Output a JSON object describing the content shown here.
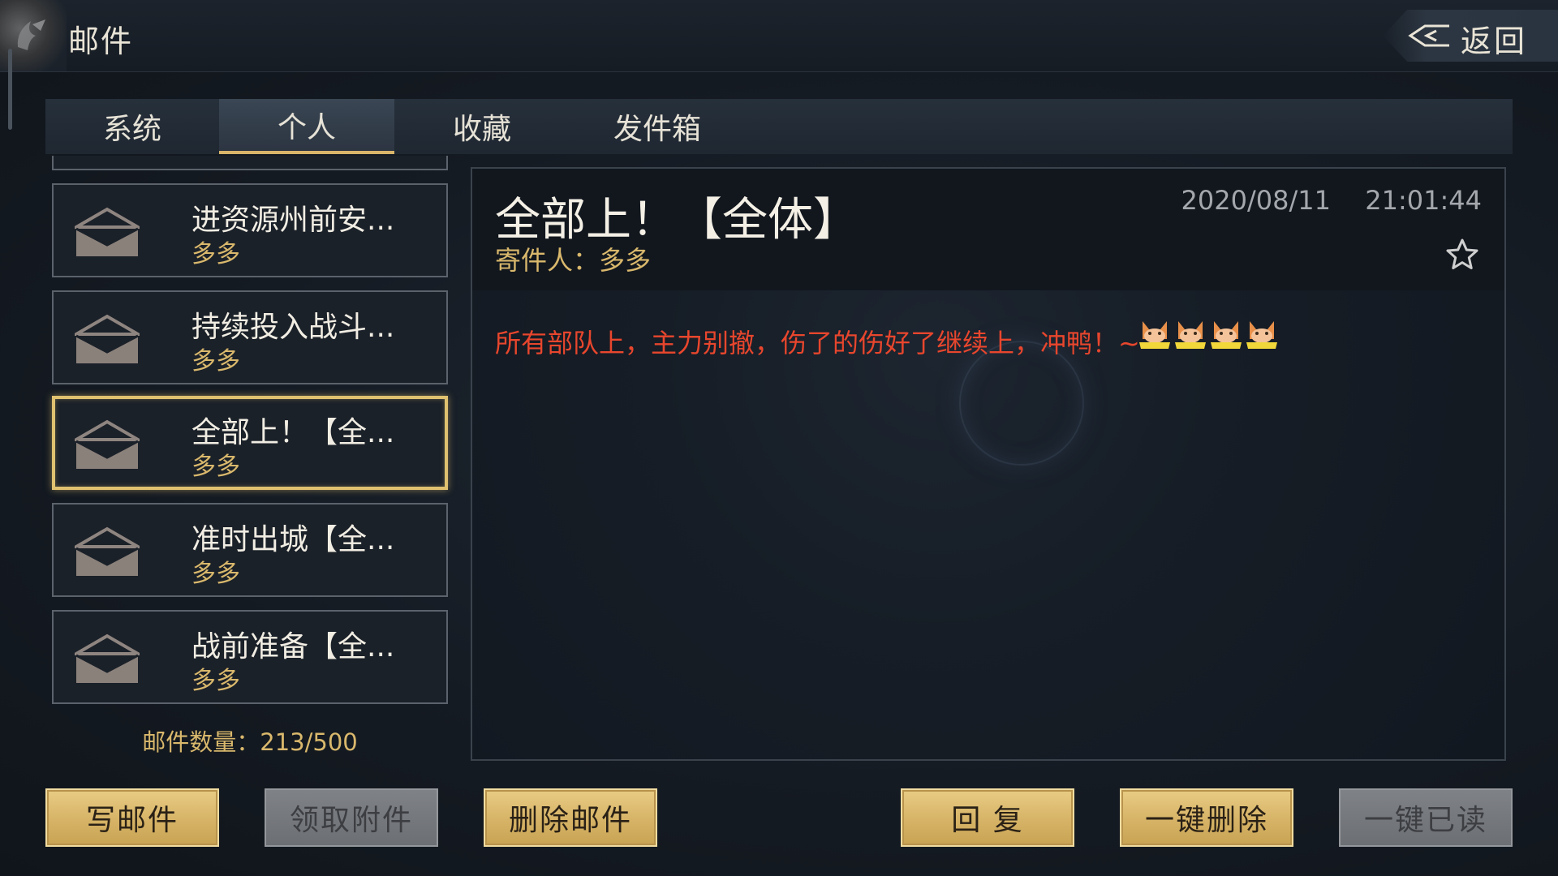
{
  "header": {
    "title": "邮件",
    "back_label": "返回"
  },
  "tabs": [
    {
      "label": "系统",
      "active": false
    },
    {
      "label": "个人",
      "active": true
    },
    {
      "label": "收藏",
      "active": false
    },
    {
      "label": "发件箱",
      "active": false
    }
  ],
  "mail_list": {
    "items": [
      {
        "subject": "进资源州前安...",
        "sender": "多多",
        "selected": false
      },
      {
        "subject": "持续投入战斗...",
        "sender": "多多",
        "selected": false
      },
      {
        "subject": "全部上！【全...",
        "sender": "多多",
        "selected": true
      },
      {
        "subject": "准时出城【全...",
        "sender": "多多",
        "selected": false
      },
      {
        "subject": "战前准备【全...",
        "sender": "多多",
        "selected": false
      }
    ],
    "count_label": "邮件数量：213/500"
  },
  "mail_view": {
    "title": "全部上！【全体】",
    "sender_label": "寄件人：多多",
    "date": "2020/08/11",
    "time": "21:01:44",
    "body": "所有部队上，主力别撤，伤了的伤好了继续上，冲鸭！~",
    "emoji": [
      "fox-emoji",
      "fox-emoji",
      "fox-emoji",
      "fox-emoji"
    ]
  },
  "actions": {
    "write": "写邮件",
    "claim": "领取附件",
    "delete": "删除邮件",
    "reply": "回 复",
    "delete_all": "一键删除",
    "read_all": "一键已读"
  },
  "colors": {
    "gold_accent": "#d9b86c",
    "selection_border": "#e0c170",
    "body_text_red": "#e8462d"
  }
}
